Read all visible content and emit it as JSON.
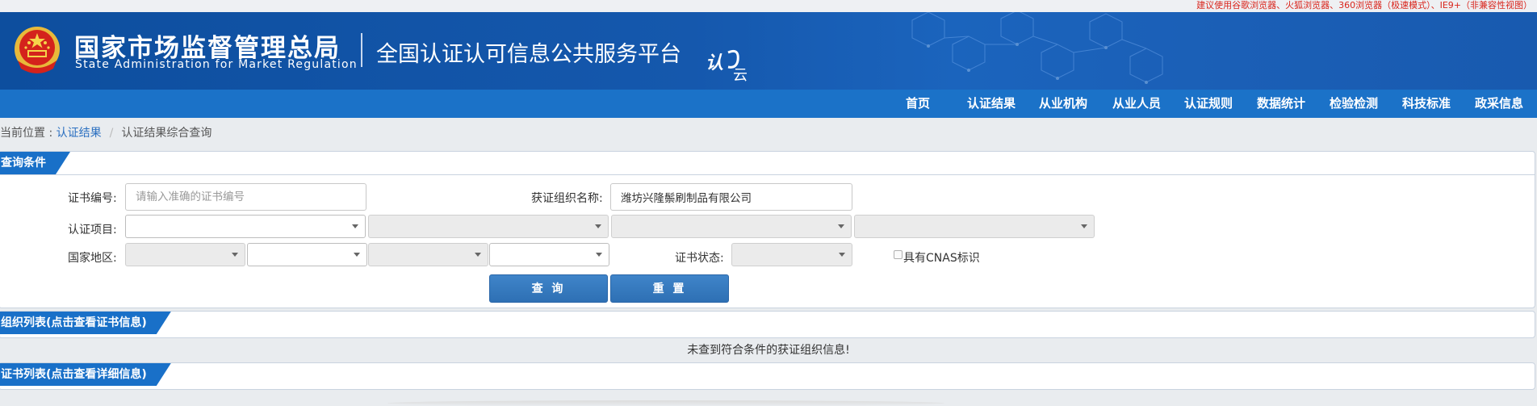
{
  "browser_tip": "建议使用谷歌浏览器、火狐浏览器、360浏览器（极速模式）、IE9+（非兼容性视图）",
  "header": {
    "org_cn": "国家市场监督管理总局",
    "org_en": "State Administration  for  Market Regulation",
    "platform": "全国认证认可信息公共服务平台",
    "logo_text": "认云"
  },
  "nav": [
    "首页",
    "认证结果",
    "从业机构",
    "从业人员",
    "认证规则",
    "数据统计",
    "检验检测",
    "科技标准",
    "政采信息"
  ],
  "breadcrumb": {
    "prefix": "当前位置 : ",
    "link": "认证结果",
    "separator": "/",
    "current": "认证结果综合查询"
  },
  "query_panel": {
    "title": "查询条件",
    "cert_no_label": "证书编号:",
    "cert_no_placeholder": "请输入准确的证书编号",
    "cert_no_value": "",
    "org_name_label": "获证组织名称:",
    "org_name_value": "潍坊兴隆鬃刷制品有限公司",
    "project_label": "认证项目:",
    "region_label": "国家地区:",
    "status_label": "证书状态:",
    "cnas_label": "具有CNAS标识",
    "query_button": "查 询",
    "reset_button": "重 置"
  },
  "org_list": {
    "title": "组织列表(点击查看证书信息)",
    "empty_message": "未查到符合条件的获证组织信息!"
  },
  "cert_list": {
    "title": "证书列表(点击查看详细信息)"
  },
  "colors": {
    "header_blue": "#1558ad",
    "nav_blue": "#1b72c8",
    "tab_blue": "#1970c8",
    "button_blue": "#2e70b4",
    "tip_red": "#d9251c"
  }
}
